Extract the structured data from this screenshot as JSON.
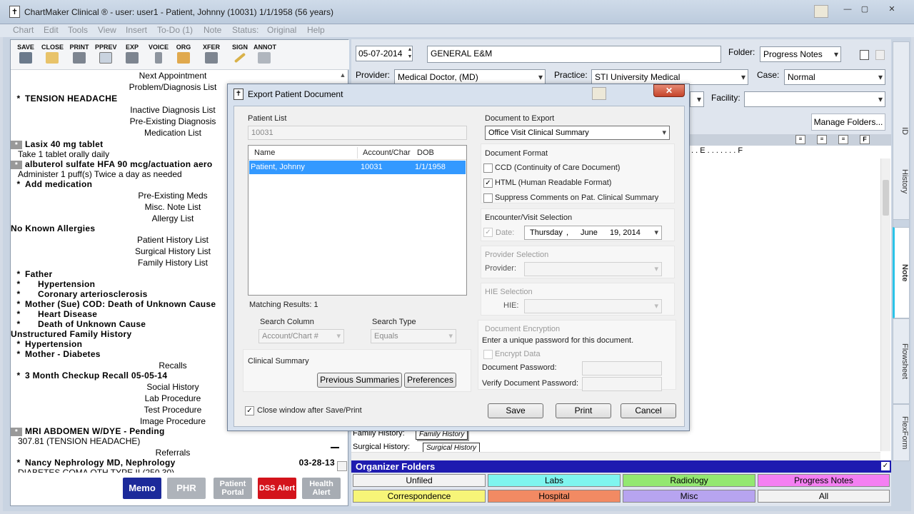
{
  "window": {
    "title": "ChartMaker Clinical ® - user: user1 - Patient, Johnny (10031) 1/1/1958 (56 years)",
    "minimize": "—",
    "maximize": "▢",
    "close": "✕"
  },
  "menu": [
    "Chart",
    "Edit",
    "Tools",
    "View",
    "Insert",
    "To-Do (1)",
    "Note",
    "Status:",
    "Original",
    "Help"
  ],
  "toolbar": [
    "SAVE",
    "CLOSE",
    "PRINT",
    "PPREV",
    "EXP",
    "VOICE",
    "ORG",
    "XFER",
    "SIGN",
    "ANNOT"
  ],
  "chart_items": [
    {
      "text": "Next Appointment",
      "kind": "header"
    },
    {
      "text": "Problem/Diagnosis List",
      "kind": "header"
    },
    {
      "text": "TENSION HEADACHE",
      "kind": "item",
      "star": "*"
    },
    {
      "text": "Inactive Diagnosis List",
      "kind": "header"
    },
    {
      "text": "Pre-Existing Diagnosis",
      "kind": "header"
    },
    {
      "text": "Medication List",
      "kind": "header"
    },
    {
      "text": "Lasix 40 mg tablet",
      "kind": "item",
      "star": "*",
      "boxed": true
    },
    {
      "text": "Take 1 tablet orally daily",
      "kind": "sub"
    },
    {
      "text": "albuterol sulfate HFA 90 mcg/actuation aero",
      "kind": "item",
      "star": "*",
      "boxed": true
    },
    {
      "text": "Administer 1  puff(s) Twice a day as needed",
      "kind": "sub"
    },
    {
      "text": "Add medication",
      "kind": "item",
      "star": "*"
    },
    {
      "text": "Pre-Existing Meds",
      "kind": "header"
    },
    {
      "text": "Misc. Note List",
      "kind": "header"
    },
    {
      "text": "Allergy List",
      "kind": "header"
    },
    {
      "text": "No Known Allergies",
      "kind": "plain"
    },
    {
      "text": "Patient History List",
      "kind": "header"
    },
    {
      "text": "Surgical History List",
      "kind": "header"
    },
    {
      "text": "Family History List",
      "kind": "header"
    },
    {
      "text": "Father",
      "kind": "item",
      "star": "*"
    },
    {
      "text": "Hypertension",
      "kind": "indent",
      "star": "*"
    },
    {
      "text": "Coronary arteriosclerosis",
      "kind": "indent",
      "star": "*"
    },
    {
      "text": "Mother (Sue) COD: Death of Unknown Cause",
      "kind": "item",
      "star": "*"
    },
    {
      "text": "Heart Disease",
      "kind": "indent",
      "star": "*"
    },
    {
      "text": "Death of Unknown Cause",
      "kind": "indent",
      "star": "*"
    },
    {
      "text": "Unstructured Family History",
      "kind": "plain"
    },
    {
      "text": "Hypertension",
      "kind": "item",
      "star": "*"
    },
    {
      "text": "Mother - Diabetes",
      "kind": "item",
      "star": "*"
    },
    {
      "text": "Recalls",
      "kind": "header"
    },
    {
      "text": "3 Month Checkup Recall 05-05-14",
      "kind": "item",
      "star": "*"
    },
    {
      "text": "Social History",
      "kind": "header"
    },
    {
      "text": "Lab Procedure",
      "kind": "header"
    },
    {
      "text": "Test Procedure",
      "kind": "header"
    },
    {
      "text": "Image Procedure",
      "kind": "header"
    },
    {
      "text": "MRI ABDOMEN W/DYE - Pending",
      "kind": "item",
      "star": "*",
      "boxed": true
    },
    {
      "text": "307.81 (TENSION HEADACHE)",
      "kind": "sub"
    },
    {
      "text": "Referrals",
      "kind": "header"
    },
    {
      "text": "Nancy Nephrology MD, Nephrology",
      "kind": "item",
      "star": "*",
      "right": "03-28-13"
    },
    {
      "text": "DIABETES COMA OTH TYPE II (250.30)",
      "kind": "sub"
    }
  ],
  "bottom_buttons": [
    {
      "label": "Memo",
      "color": "#1c2a9a"
    },
    {
      "label": "PHR",
      "color": "#aeb3ba"
    },
    {
      "label": "Patient Portal",
      "color": "#a7acb3"
    },
    {
      "label": "DSS Alert",
      "color": "#d3131b"
    },
    {
      "label": "Health Alert",
      "color": "#a7acb3"
    }
  ],
  "note": {
    "date": "05-07-2014",
    "title": "GENERAL E&M",
    "folder_label": "Folder:",
    "folder": "Progress Notes",
    "provider_label": "Provider:",
    "provider": "Medical Doctor, (MD)",
    "practice_label": "Practice:",
    "practice": "STI University Medical",
    "case_label": "Case:",
    "case": "Normal",
    "facility_label": "Facility:",
    "manage_folders": "Manage Folders...",
    "ruler": ". . E . . . . . . . F",
    "family_history_label": "Family History:",
    "family_history_btn": "Family History",
    "surgical_history_label": "Surgical History:",
    "surgical_history_btn": "Surgical History"
  },
  "side_tabs": [
    "ID",
    "History",
    "Note",
    "Flowsheet",
    "FlexForm"
  ],
  "organizer": {
    "title": "Organizer Folders",
    "folders": [
      {
        "label": "Unfiled",
        "color": "#f2f2f2"
      },
      {
        "label": "Labs",
        "color": "#7ff5ef"
      },
      {
        "label": "Radiology",
        "color": "#93e870"
      },
      {
        "label": "Progress Notes",
        "color": "#f47ff2"
      },
      {
        "label": "Correspondence",
        "color": "#f7f578"
      },
      {
        "label": "Hospital",
        "color": "#f28a63"
      },
      {
        "label": "Misc",
        "color": "#b7a4f0"
      },
      {
        "label": "All",
        "color": "#f2f2f2"
      }
    ]
  },
  "dialog": {
    "title": "Export Patient Document",
    "close": "✕",
    "patient_list_label": "Patient List",
    "patient_search": "10031",
    "columns": [
      "Name",
      "Account/Char",
      "DOB"
    ],
    "rows": [
      {
        "name": "Patient, Johnny",
        "account": "10031",
        "dob": "1/1/1958"
      }
    ],
    "matching": "Matching Results: 1",
    "search_column_label": "Search Column",
    "search_column": "Account/Chart #",
    "search_type_label": "Search Type",
    "search_type": "Equals",
    "clinical_summary_label": "Clinical Summary",
    "previous_summaries": "Previous Summaries",
    "preferences": "Preferences",
    "close_window": "Close window after Save/Print",
    "doc_to_export_label": "Document to Export",
    "doc_to_export": "Office Visit Clinical Summary",
    "doc_format_label": "Document Format",
    "format_ccd": "CCD (Continuity of Care Document)",
    "format_html": "HTML (Human Readable Format)",
    "suppress_comments": "Suppress Comments on Pat. Clinical Summary",
    "encounter_label": "Encounter/Visit Selection",
    "date_label": "Date:",
    "date_day": "Thursday",
    "date_month": "June",
    "date_num": "19, 2014",
    "provider_sel_label": "Provider Selection",
    "provider_label": "Provider:",
    "hie_sel_label": "HIE Selection",
    "hie_label": "HIE:",
    "encryption_label": "Document Encryption",
    "encryption_hint": "Enter a unique password for this document.",
    "encrypt_data": "Encrypt Data",
    "doc_password": "Document Password:",
    "verify_password": "Verify Document Password:",
    "save": "Save",
    "print": "Print",
    "cancel": "Cancel"
  }
}
